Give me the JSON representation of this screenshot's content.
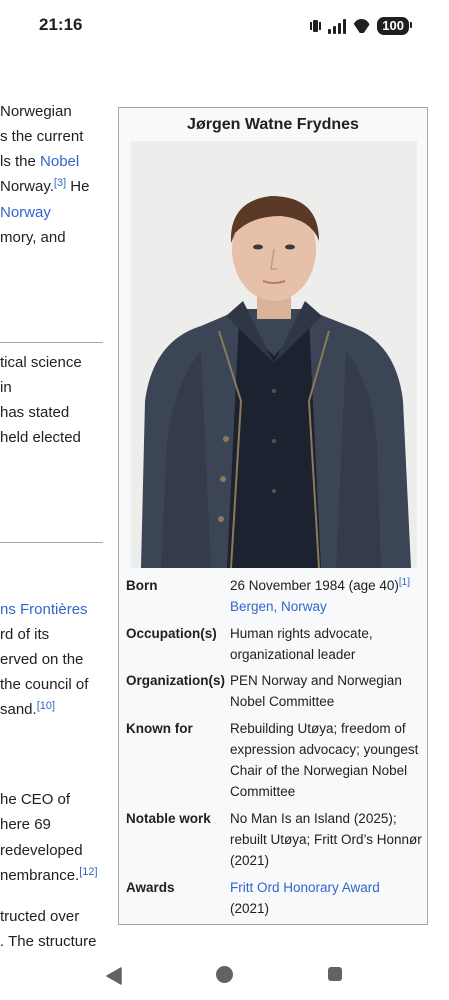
{
  "status_bar": {
    "time": "21:16",
    "battery": "100"
  },
  "article": {
    "lines": [
      {
        "text": "Norwegian",
        "link": false
      },
      {
        "text": "s the current",
        "link": false
      },
      {
        "pre": "ls the ",
        "link_text": "Nobel"
      },
      {
        "text": " Norway.",
        "sup": "[3]",
        "post": " He"
      },
      {
        "link_text": "Norway"
      },
      {
        "text": "mory, and"
      }
    ],
    "section2": [
      "tical science",
      "in",
      "has stated",
      "held elected"
    ],
    "section3": {
      "link_line": "ns Frontières",
      "lines": [
        "rd of its",
        "erved on the",
        " the council of"
      ],
      "sand": "sand.",
      "sand_sup": "[10]"
    },
    "section4": [
      "he CEO of",
      "here 69",
      "redeveloped"
    ],
    "section4_last": "nembrance.",
    "section4_sup": "[12]",
    "section5": [
      "tructed over",
      ". The structure"
    ]
  },
  "infobox": {
    "title": "Jørgen Watne Frydnes",
    "photo_alt": "Jørgen Watne Frydnes",
    "rows": [
      {
        "label": "Born",
        "value": "26 November 1984 (age 40)",
        "sup": "[1]",
        "link": "Bergen, Norway"
      },
      {
        "label": "Occupation(s)",
        "value": "Human rights advocate, organizational leader"
      },
      {
        "label": "Organization(s)",
        "value": "PEN Norway and Norwegian Nobel Committee"
      },
      {
        "label": "Known for",
        "value": "Rebuilding Utøya; freedom of expression advocacy; youngest Chair of the Norwegian Nobel Committee"
      },
      {
        "label": "Notable work",
        "value": "No Man Is an Island (2025); rebuilt Utøya; Fritt Ord’s Honnør (2021)"
      },
      {
        "label": "Awards",
        "link": "Fritt Ord Honorary Award",
        "value": "(2021)"
      }
    ]
  },
  "colors": {
    "link": "#3366cc",
    "text": "#202122",
    "border": "#a2a9b1",
    "infobox_bg": "#f8f9fa"
  }
}
